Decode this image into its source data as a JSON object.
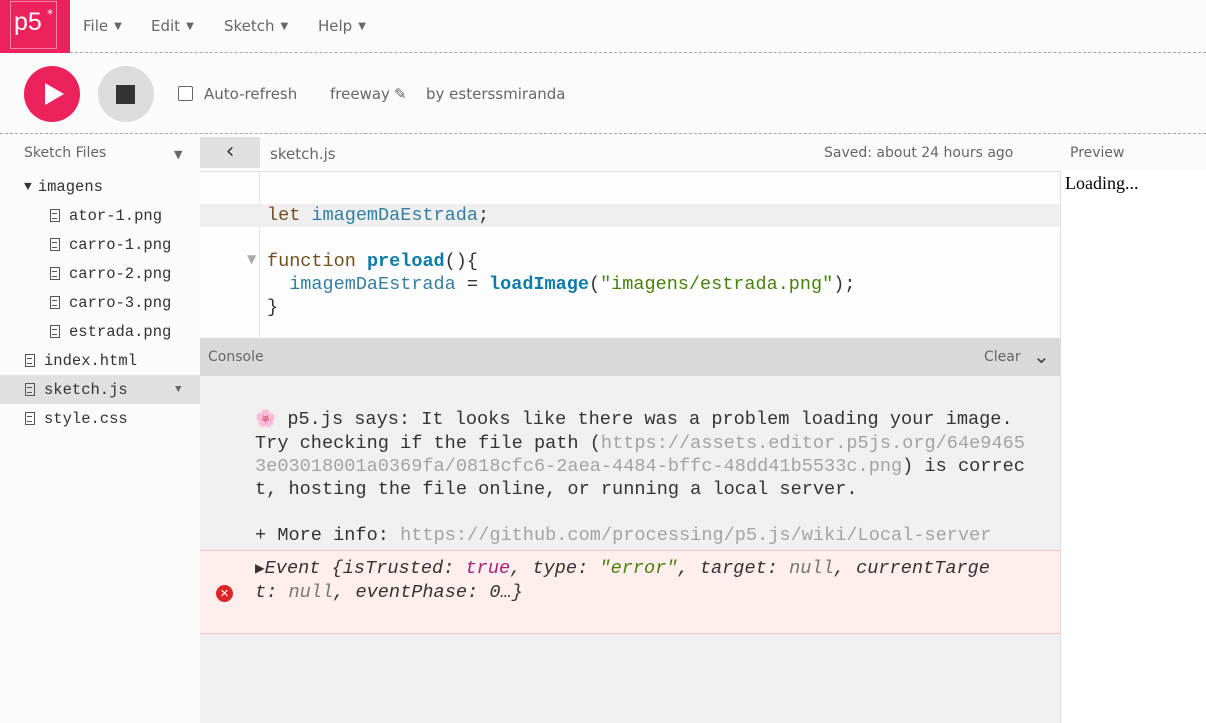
{
  "nav": {
    "logo": "p5",
    "logo_star": "*",
    "menus": [
      {
        "label": "File"
      },
      {
        "label": "Edit"
      },
      {
        "label": "Sketch"
      },
      {
        "label": "Help"
      }
    ]
  },
  "toolbar": {
    "auto_refresh_label": "Auto-refresh",
    "auto_refresh_checked": false,
    "sketch_name": "freeway",
    "author": "by esterssmiranda"
  },
  "files": {
    "header": "Sketch Files",
    "items": [
      {
        "name": "imagens",
        "type": "folder",
        "expanded": true
      },
      {
        "name": "ator-1.png",
        "type": "file"
      },
      {
        "name": "carro-1.png",
        "type": "file"
      },
      {
        "name": "carro-2.png",
        "type": "file"
      },
      {
        "name": "carro-3.png",
        "type": "file"
      },
      {
        "name": "estrada.png",
        "type": "file"
      },
      {
        "name": "index.html",
        "type": "file"
      },
      {
        "name": "sketch.js",
        "type": "file",
        "selected": true
      },
      {
        "name": "style.css",
        "type": "file"
      }
    ]
  },
  "editor": {
    "filename": "sketch.js",
    "saved": "Saved: about 24 hours ago",
    "code": {
      "l1_kw": "let",
      "l1_var": " imagemDaEstrada",
      "l1_end": ";",
      "l2_kw": "function",
      "l2_fn": "preload",
      "l2_end": "(){",
      "l3_var": "  imagemDaEstrada",
      "l3_eq": " = ",
      "l3_fn": "loadImage",
      "l3_open": "(",
      "l3_str": "\"imagens/estrada.png\"",
      "l3_end": ");",
      "l4": "}"
    }
  },
  "console": {
    "title": "Console",
    "clear": "Clear",
    "msg": {
      "line1": " p5.js says: It looks like there was a problem loading your image.",
      "line2a": "Try checking if the file path (",
      "url1a": "https://assets.editor.p5js.org/64e9465",
      "url1b": "3e03018001a0369fa/0818cfc6-2aea-4484-bffc-48dd41b5533c.png",
      "line3b": ") is correc",
      "line4": "t, hosting the file online, or running a local server.",
      "more": "+ More info: ",
      "url2": "https://github.com/processing/p5.js/wiki/Local-server"
    },
    "error": {
      "a": "Event {isTrusted: ",
      "true": "true",
      "b": ", type: ",
      "str": "\"error\"",
      "c": ", target: ",
      "null1": "null",
      "d": ", currentTarge",
      "e": "t: ",
      "null2": "null",
      "f": ", eventPhase: 0…}"
    }
  },
  "preview": {
    "title": "Preview",
    "status": "Loading..."
  },
  "colors": {
    "accent": "#ed225d",
    "error_bg": "#ffeeee"
  }
}
